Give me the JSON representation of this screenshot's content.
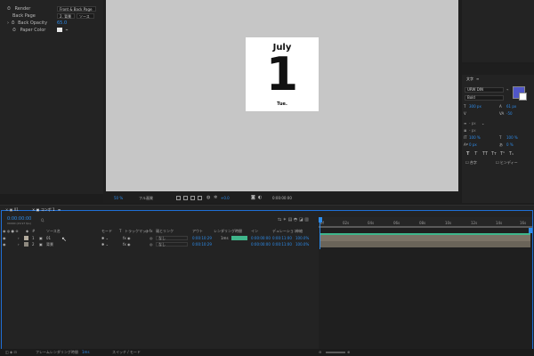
{
  "effect_controls": {
    "render_label": "Render",
    "render_value": "Front & Back Page",
    "back_page_label": "Back Page",
    "back_page_value": "2. 背景",
    "back_page_value_extra": "ソース",
    "back_opacity_label": "Back Opacity",
    "back_opacity_value": "65.0",
    "paper_color_label": "Paper Color"
  },
  "calendar": {
    "month": "July",
    "day": "1",
    "weekday": "Tue."
  },
  "viewer_toolbar": {
    "zoom": "50 %",
    "quality": "フル画質",
    "timecode": "0:00:00:00",
    "exposure": "+0.0"
  },
  "character_panel": {
    "title": "文字",
    "font": "URW DIN",
    "style": "Bold",
    "size": "300 px",
    "leading": "61 px",
    "kerning": "",
    "tracking": "-50",
    "vert_scale": "100 %",
    "horiz_scale": "100 %",
    "baseline": "0 px",
    "tsume": "0 %",
    "ligature": "合字",
    "hindi": "ヒンディー"
  },
  "timeline": {
    "tab_render_queue": "01",
    "tab_comp": "コンポ 1",
    "current_time": "0:00:00:00",
    "current_frames": "00000 (29.97 fps)",
    "search_placeholder": "Q.",
    "col_source": "ソース名",
    "col_mode": "モード",
    "col_t": "T",
    "col_trkmat": "トラックマット",
    "col_parent": "親とリンク",
    "col_out": "アウト",
    "col_render": "レンダリング時間",
    "col_in": "イン",
    "col_duration": "デュレーション",
    "col_stretch": "伸縮",
    "ruler": [
      "0f",
      "02s",
      "04s",
      "06s",
      "08s",
      "10s",
      "12s",
      "14s",
      "16s"
    ],
    "layers": [
      {
        "num": "1",
        "name": "01",
        "parent": "なし",
        "out": "0:00:10:29",
        "render": "1ms",
        "in": "0:00:00:00",
        "duration": "0:00:11:00",
        "stretch": "100.0%"
      },
      {
        "num": "2",
        "name": "背景",
        "parent": "なし",
        "out": "0:00:10:29",
        "render": "",
        "in": "0:00:00:00",
        "duration": "0:00:11:00",
        "stretch": "100.0%"
      }
    ],
    "footer_render": "フレームレンダリング時間",
    "footer_render_value": "1ms",
    "footer_switch": "スイッチ / モード"
  },
  "colors": {
    "accent": "#2d8ceb",
    "render_bar": "#3fb68b",
    "layer_bar": "#7b7366"
  }
}
